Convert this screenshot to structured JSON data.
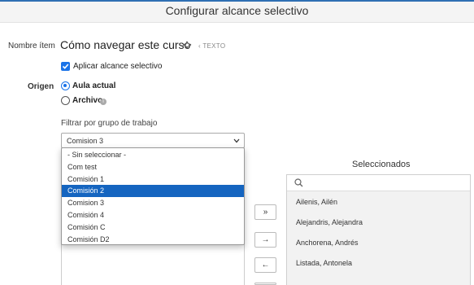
{
  "header": {
    "title": "Configurar alcance selectivo"
  },
  "item": {
    "label": "Nombre ítem",
    "name": "Cómo navegar este curso",
    "type": "TEXTO",
    "type_icon": "content-type-icon"
  },
  "selective_scope": {
    "label": "Aplicar alcance selectivo",
    "checked": true
  },
  "origin": {
    "label": "Origen",
    "options": [
      {
        "label": "Aula actual",
        "selected": true
      },
      {
        "label": "Archivo",
        "selected": false
      }
    ],
    "info_icon": "info-icon"
  },
  "filter": {
    "label": "Filtrar por grupo de trabajo",
    "value": "Comision 3",
    "options": [
      {
        "label": "- Sin seleccionar -",
        "highlighted": false
      },
      {
        "label": "Com test",
        "highlighted": false
      },
      {
        "label": "Comisión 1",
        "highlighted": false
      },
      {
        "label": "Comisión 2",
        "highlighted": true
      },
      {
        "label": "Comision 3",
        "highlighted": false
      },
      {
        "label": "Comisión 4",
        "highlighted": false
      },
      {
        "label": "Comisión C",
        "highlighted": false
      },
      {
        "label": "Comisión D2",
        "highlighted": false
      }
    ]
  },
  "transfer_buttons": {
    "add_all": "»",
    "add": "→",
    "remove": "←"
  },
  "selected": {
    "title": "Seleccionados",
    "search_icon": "search-icon",
    "items": [
      "Ailenis, Ailén",
      "Alejandris, Alejandra",
      "Anchorena, Andrés",
      "Listada, Antonela"
    ]
  },
  "colors": {
    "accent": "#1a73e8",
    "highlight": "#1565c0",
    "top_bar": "#2f6fb3"
  }
}
